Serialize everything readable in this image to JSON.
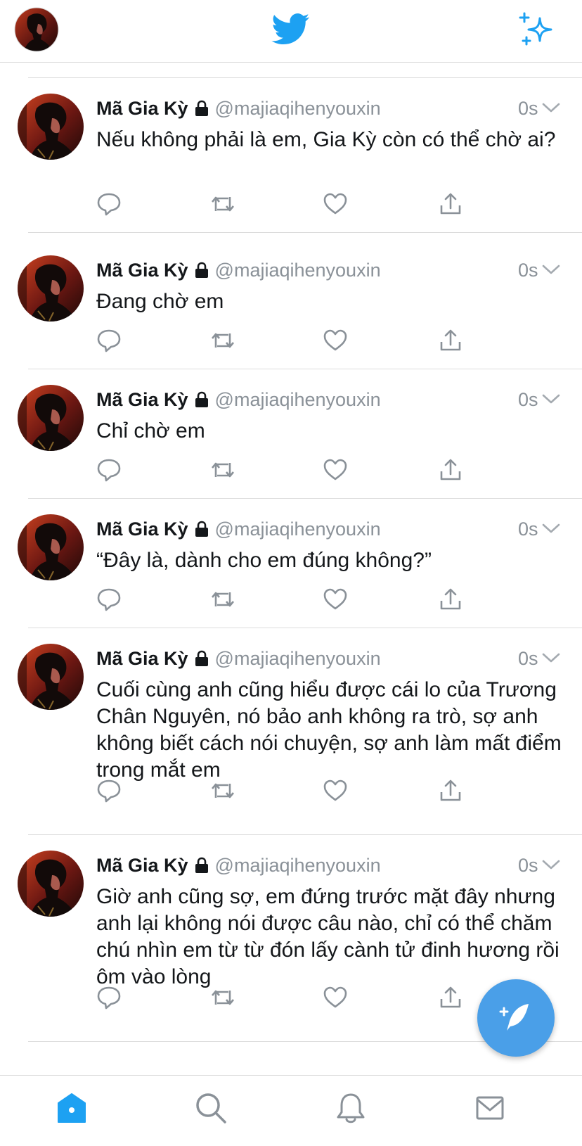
{
  "topbar": {
    "avatar_icon": "profile-avatar",
    "logo_icon": "twitter-bird",
    "sparkle_icon": "sparkle-icon",
    "brand_color": "#1da1f2"
  },
  "tweets": [
    {
      "name": "Mã Gia Kỳ",
      "handle": "@majiaqihenyouxin",
      "time": "0s",
      "text": "Nếu không phải là em, Gia Kỳ còn có thể chờ ai?"
    },
    {
      "name": "Mã Gia Kỳ",
      "handle": "@majiaqihenyouxin",
      "time": "0s",
      "text": "Đang chờ em"
    },
    {
      "name": "Mã Gia Kỳ",
      "handle": "@majiaqihenyouxin",
      "time": "0s",
      "text": "Chỉ chờ em"
    },
    {
      "name": "Mã Gia Kỳ",
      "handle": "@majiaqihenyouxin",
      "time": "0s",
      "text": "“Đây là, dành cho em đúng không?”"
    },
    {
      "name": "Mã Gia Kỳ",
      "handle": "@majiaqihenyouxin",
      "time": "0s",
      "text": "Cuối cùng anh cũng hiểu được cái lo của Trương Chân Nguyên, nó bảo anh không ra trò, sợ anh không biết cách nói chuyện, sợ anh làm mất điểm trong mắt em"
    },
    {
      "name": "Mã Gia Kỳ",
      "handle": "@majiaqihenyouxin",
      "time": "0s",
      "text": "Giờ anh cũng sợ, em đứng trước mặt đây nhưng anh lại không nói được câu nào, chỉ có thể chăm chú nhìn em từ từ đón lấy cành tử đinh hương rồi ôm vào lòng"
    }
  ],
  "actions": [
    "reply-icon",
    "retweet-icon",
    "like-icon",
    "share-icon"
  ],
  "fab": {
    "icon": "compose-tweet-icon",
    "color": "#4a9fe8"
  },
  "tabbar": {
    "items": [
      "home-icon",
      "search-icon",
      "notifications-icon",
      "messages-icon"
    ],
    "active_color": "#1da1f2",
    "inactive_color": "#8a9198"
  }
}
